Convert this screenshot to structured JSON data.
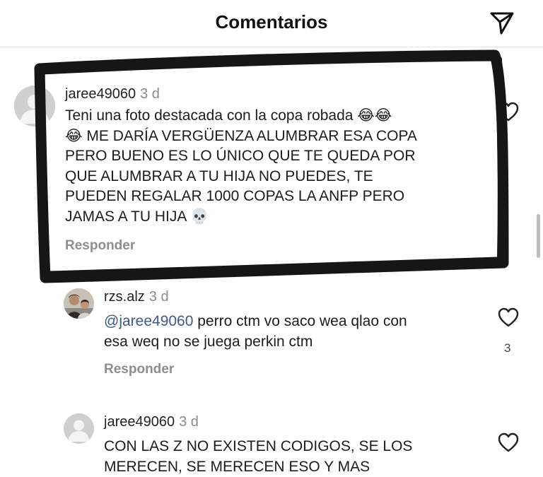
{
  "header": {
    "title": "Comentarios",
    "share_icon": "paper-plane-icon"
  },
  "comments": [
    {
      "username": "jaree49060",
      "time": "3 d",
      "lines": [
        "Teni una foto destacada con la copa robada 😂😂",
        "😂 ME DARÍA VERGÜENZA ALUMBRAR ESA COPA",
        "PERO BUENO ES LO ÚNICO QUE TE QUEDA POR",
        "QUE ALUMBRAR A TU HIJA NO PUEDES, TE",
        "PUEDEN REGALAR 1000 COPAS LA ANFP PERO",
        "JAMAS A TU HIJA 💀"
      ],
      "reply_label": "Responder"
    },
    {
      "username": "rzs.alz",
      "time": "3 d",
      "mention": "@jaree49060",
      "line1_rest": " perro ctm vo saco wea qlao con",
      "line2": "esa weq no se juega perkin ctm",
      "reply_label": "Responder",
      "likes": "3"
    },
    {
      "username": "jaree49060",
      "time": "3 d",
      "lines": [
        "CON LAS Z NO EXISTEN CODIGOS, SE LOS",
        "MERECEN, SE MERECEN ESO Y MAS"
      ]
    }
  ]
}
